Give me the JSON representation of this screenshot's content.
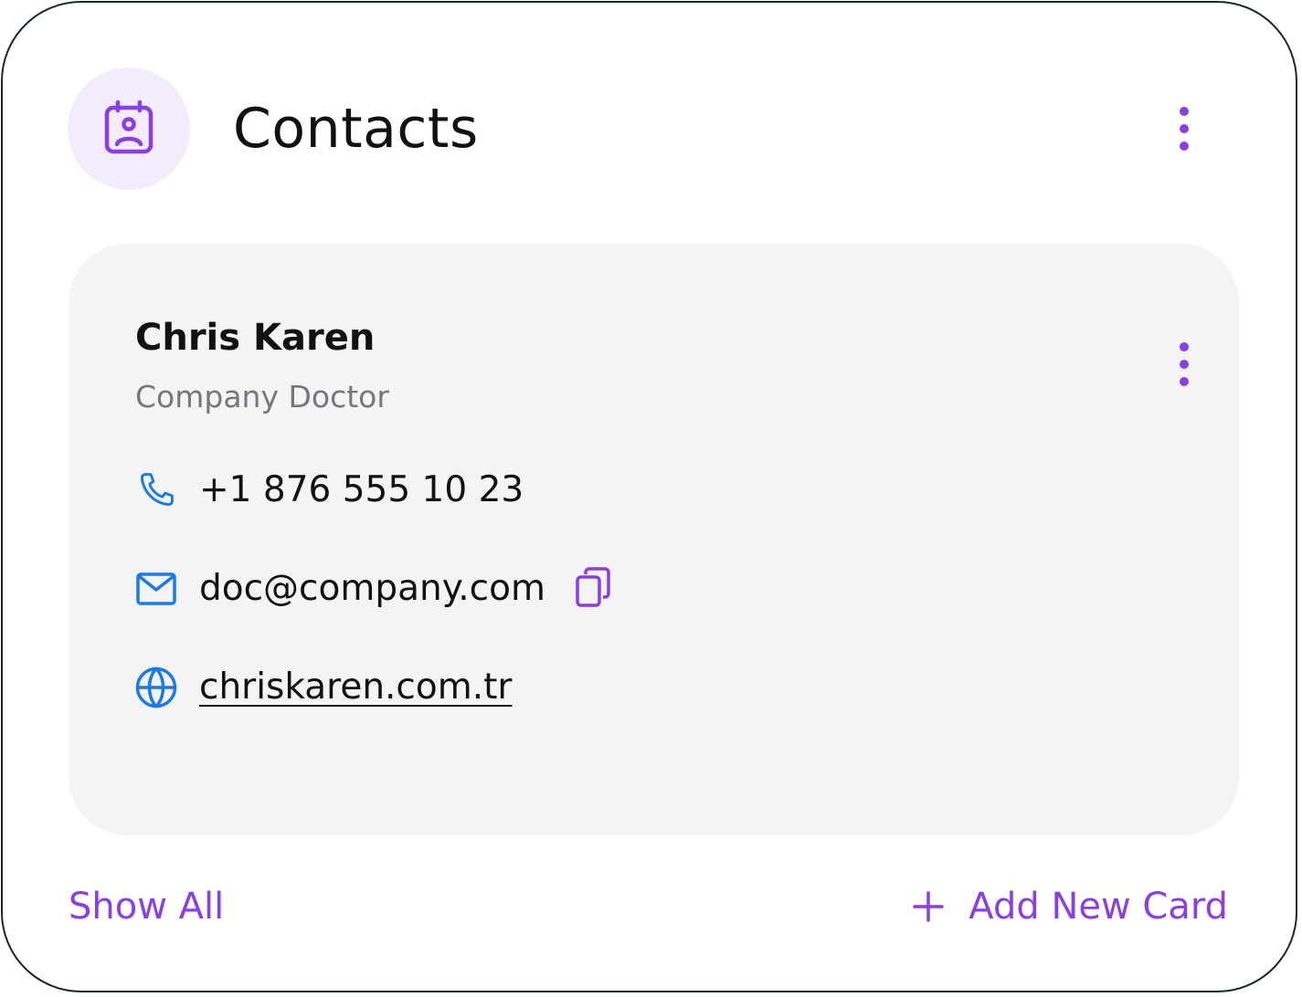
{
  "colors": {
    "accent": "#8a3ee6",
    "accent_bg": "#f2ecfc",
    "contact_icon": "#1a7ae6",
    "card_bg": "#f4f4f4"
  },
  "header": {
    "icon": "contact-card-icon",
    "title": "Contacts",
    "menu_icon": "more-vertical-icon"
  },
  "contact": {
    "name": "Chris Karen",
    "role": "Company Doctor",
    "menu_icon": "more-vertical-icon",
    "phone": {
      "icon": "phone-icon",
      "value": "+1 876 555 10 23"
    },
    "email": {
      "icon": "mail-icon",
      "value": "doc@company.com",
      "copy_icon": "copy-icon"
    },
    "website": {
      "icon": "globe-icon",
      "value": "chriskaren.com.tr"
    }
  },
  "footer": {
    "show_all_label": "Show All",
    "add_new_label": "Add New Card",
    "add_icon": "plus-icon"
  }
}
